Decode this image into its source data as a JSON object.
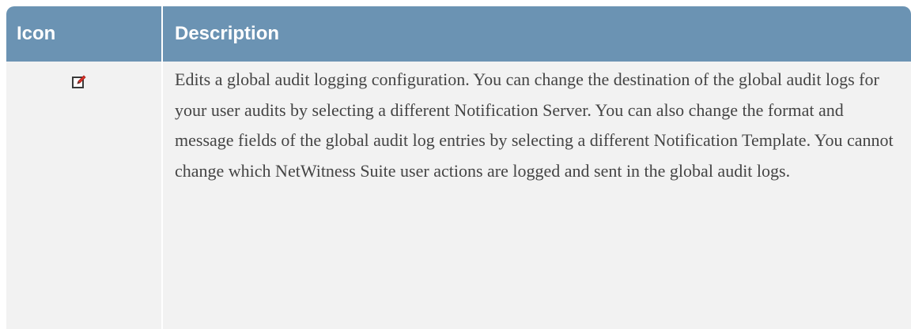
{
  "table": {
    "headers": {
      "icon": "Icon",
      "description": "Description"
    },
    "rows": [
      {
        "icon": "edit-icon",
        "description": "Edits a global audit logging configuration. You can change the destination of the global audit logs for your user audits by selecting a different Notification Server. You can also change the format and message fields of the global audit log entries by selecting a different Notification Template. You cannot change which NetWitness Suite user actions are logged and sent in the global audit logs."
      }
    ]
  },
  "colors": {
    "header_background": "#6b93b3",
    "header_text": "#ffffff",
    "row_background": "#f2f2f2",
    "body_text": "#444444",
    "icon_accent": "#d8342b"
  }
}
